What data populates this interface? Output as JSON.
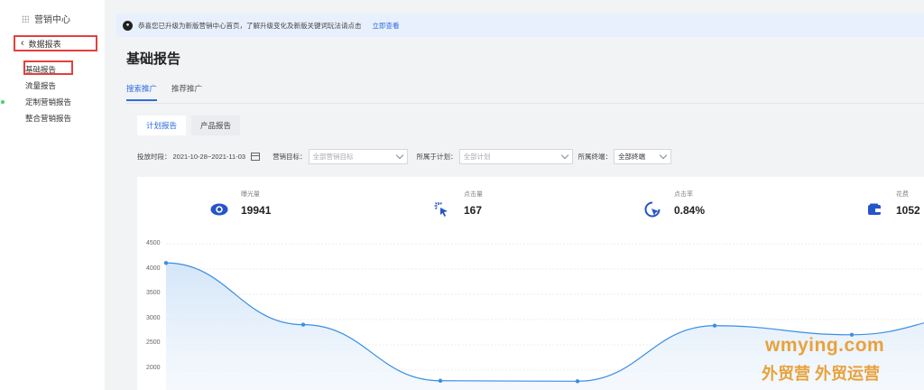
{
  "notice": {
    "text": "恭喜您已升级为新版营销中心首页，了解升级变化及新版关键词玩法请点击",
    "link": "立即查看"
  },
  "sidebar": {
    "header": "营销中心",
    "back_label": "数据报表",
    "items": [
      {
        "label": "基础报告"
      },
      {
        "label": "流量报告"
      },
      {
        "label": "定制营销报告"
      },
      {
        "label": "整合营销报告"
      }
    ]
  },
  "page_title": "基础报告",
  "tabs": [
    {
      "label": "搜索推广"
    },
    {
      "label": "推荐推广"
    }
  ],
  "subtabs": [
    {
      "label": "计划报告"
    },
    {
      "label": "产品报告"
    }
  ],
  "filters": {
    "date_label": "投放时段：",
    "date_value": "2021-10-28~2021-11-03",
    "goal_label": "营销目标：",
    "goal_placeholder": "全部营销目标",
    "plan_label": "所属于计划：",
    "plan_placeholder": "全部计划",
    "device_label": "所属终端：",
    "device_value": "全部终端"
  },
  "metrics": [
    {
      "label": "曝光量",
      "value": "19941",
      "icon": "eye-icon"
    },
    {
      "label": "点击量",
      "value": "167",
      "icon": "cursor-click-icon"
    },
    {
      "label": "点击率",
      "value": "0.84%",
      "icon": "pointer-circle-icon"
    },
    {
      "label": "花费",
      "value": "1052",
      "icon": "wallet-icon"
    }
  ],
  "chart_data": {
    "type": "line",
    "y_ticks": [
      "4500",
      "4000",
      "3500",
      "3000",
      "2500",
      "2000"
    ],
    "ylim": [
      1550,
      4650
    ],
    "values": [
      4120,
      2900,
      1790,
      1780,
      2880,
      2700,
      3100
    ],
    "color": "#3a8ee6"
  },
  "watermark": {
    "line1": "wmying.com",
    "line2": "外贸营 外贸运营"
  }
}
